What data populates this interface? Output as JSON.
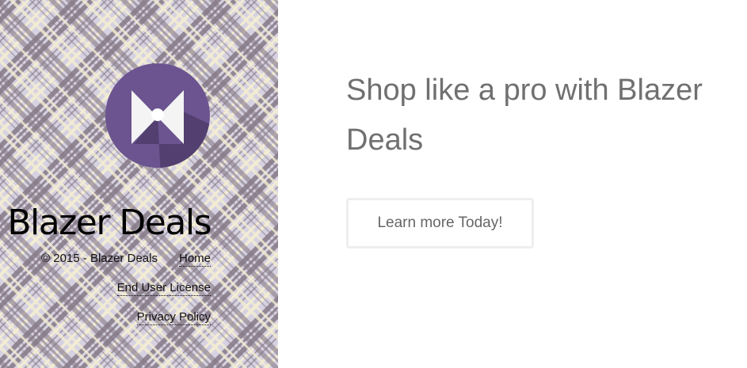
{
  "sidebar": {
    "site_title": "Blazer Deals",
    "logo_icon": "bow-tie-icon",
    "copyright": "© 2015 - Blazer Deals",
    "links": [
      {
        "label": "Home"
      },
      {
        "label": "End User License"
      },
      {
        "label": "Privacy Policy"
      }
    ],
    "colors": {
      "background": "#d7d2e2",
      "plaid_dark": "#857a86",
      "plaid_light": "#f3edd2",
      "logo_purple": "#6b5490"
    }
  },
  "main": {
    "headline": "Shop like a pro with Blazer Deals",
    "cta_label": "Learn more Today!"
  }
}
